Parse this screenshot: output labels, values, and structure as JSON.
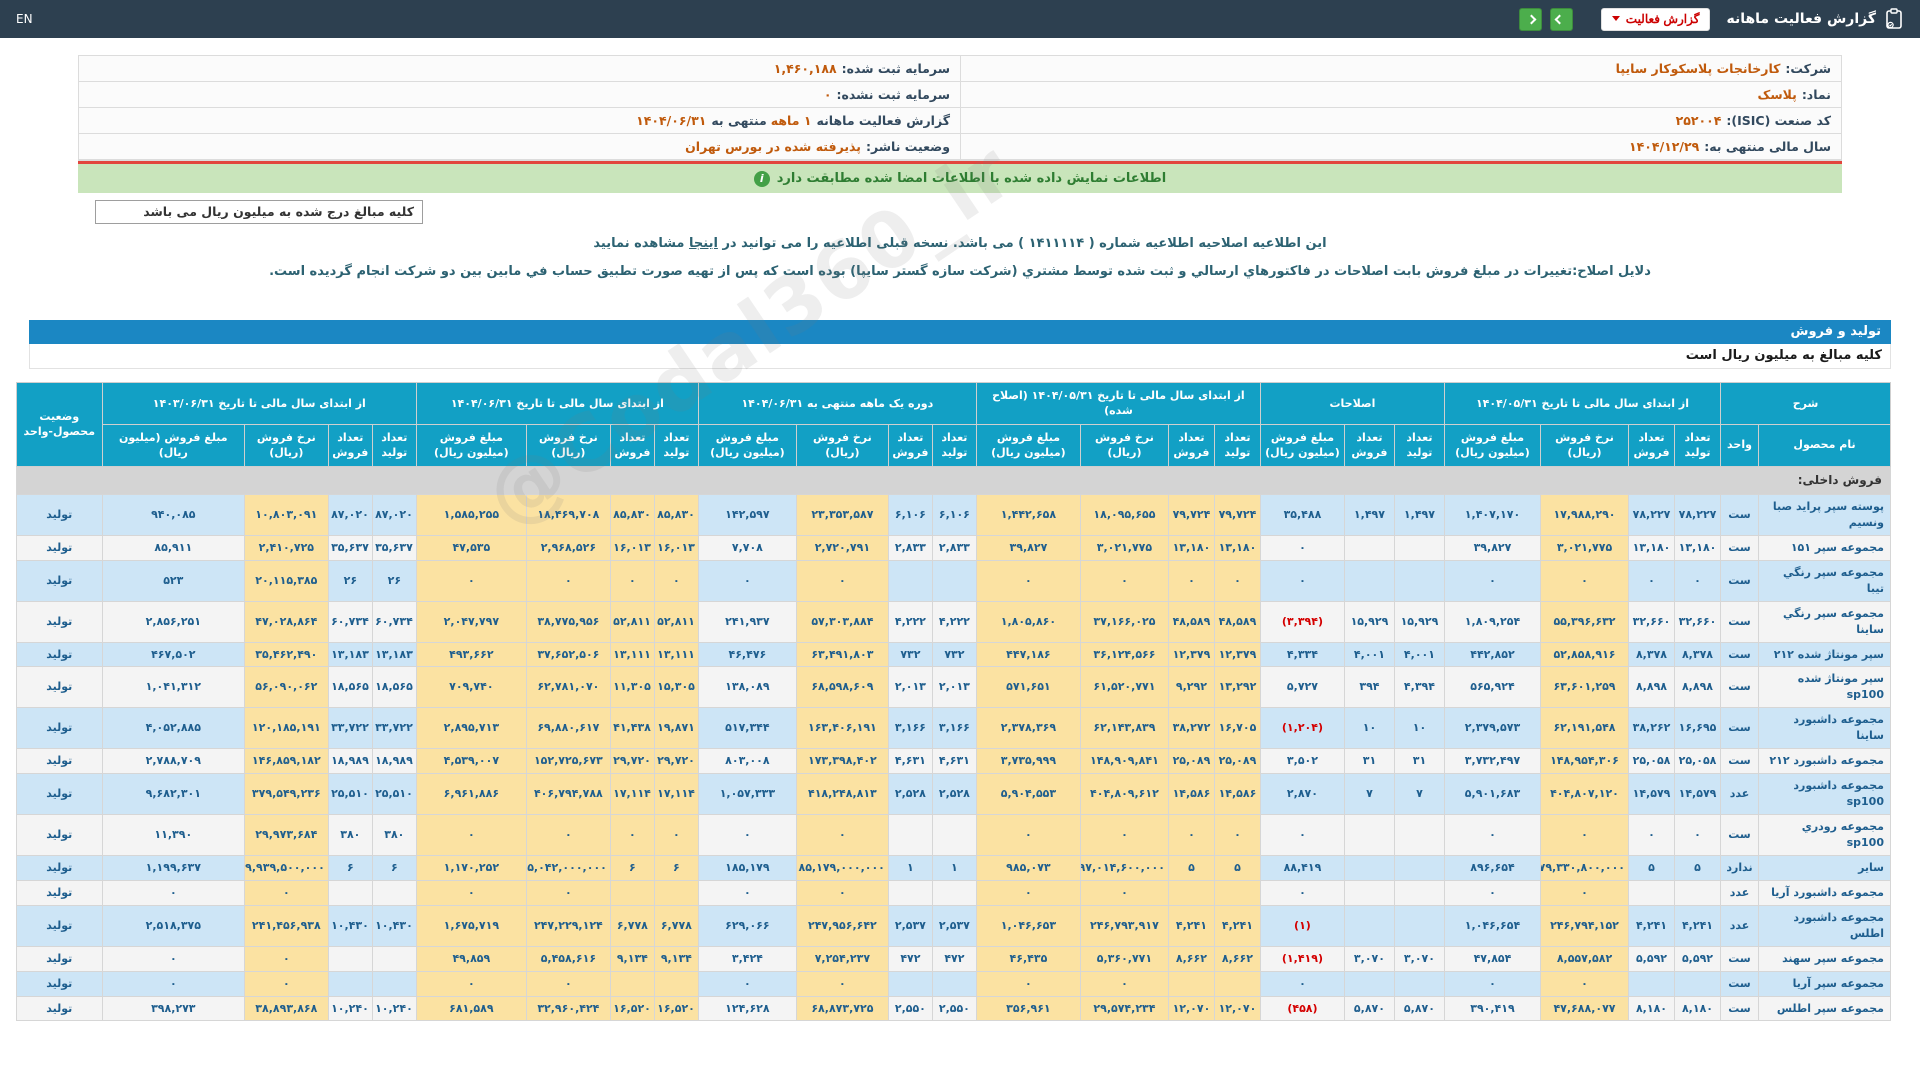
{
  "topbar": {
    "en": "EN",
    "title": "گزارش فعالیت ماهانه",
    "dropdown_label": "گزارش فعالیت",
    "accent_green": "#4cae4c",
    "accent_red": "#cc0000"
  },
  "info": {
    "right": [
      {
        "label": "شرکت:",
        "value": "کارخانجات پلاسکوکار سایپا"
      },
      {
        "label": "نماد:",
        "value": "پلاسک"
      },
      {
        "label": "کد صنعت (ISIC):",
        "value": "۲۵۲۰۰۴"
      },
      {
        "label": "سال مالی منتهی به:",
        "value": "۱۴۰۴/۱۲/۲۹"
      }
    ],
    "left": [
      {
        "label": "سرمایه ثبت شده:",
        "value": "۱,۴۶۰,۱۸۸",
        "label2": "",
        "value2": ""
      },
      {
        "label": "سرمایه ثبت نشده:",
        "value": "۰",
        "label2": "",
        "value2": ""
      },
      {
        "label": "گزارش فعالیت ماهانه",
        "value": "۱ ماهه",
        "label2": "منتهی به",
        "value2": "۱۴۰۴/۰۶/۳۱"
      },
      {
        "label": "وضعیت ناشر:",
        "value": "پذیرفته شده در بورس تهران",
        "label2": "",
        "value2": ""
      }
    ]
  },
  "banner": {
    "text": "اطلاعات نمایش داده شده با اطلاعات امضا شده مطابقت دارد",
    "icon": "info-icon",
    "color": "#2e7d32"
  },
  "million_note": "کلیه مبالغ درج شده به میلیون ریال می باشد",
  "notice": {
    "pre": "این اطلاعیه اصلاحیه اطلاعیه شماره ( ۱۴۱۱۱۱۴ ) می باشد. نسخه قبلی اطلاعیه را می توانید در",
    "link": "اینجا",
    "post": "مشاهده نمایید"
  },
  "reason": "دلایل اصلاح:تغییرات در مبلغ فروش بابت اصلاحات در فاکتورهاي ارسالي و ثبت شده توسط مشتري (شرکت سازه گستر سایپا) بوده است که پس از تهیه صورت تطبیق حساب في مابین بین دو شرکت انجام گردیده است.",
  "section_bar": "تولید و فروش",
  "units_row": "کلیه مبالغ به میلیون ریال است",
  "watermark": "@Codal360_ir",
  "table": {
    "desc": {
      "label": "شرح",
      "cols": [
        "نام محصول",
        "واحد"
      ]
    },
    "status_col": "وضعیت محصول-واحد",
    "sub": {
      "prod": "تعداد تولید",
      "sold": "تعداد فروش",
      "rate": "نرخ فروش (ریال)",
      "amount": "مبلغ فروش (میلیون ریال)"
    },
    "groups": [
      {
        "label": "از ابتدای سال مالی تا تاریخ ۱۴۰۴/۰۵/۳۱",
        "cols": [
          "prod",
          "sold",
          "rate",
          "amount"
        ]
      },
      {
        "label": "اصلاحات",
        "cols": [
          "prod",
          "sold",
          "amount"
        ]
      },
      {
        "label": "از ابتدای سال مالی تا تاریخ ۱۴۰۴/۰۵/۳۱ (اصلاح شده)",
        "cols": [
          "prod",
          "sold",
          "rate",
          "amount"
        ]
      },
      {
        "label": "دوره یک ماهه منتهی به ۱۴۰۴/۰۶/۳۱",
        "cols": [
          "prod",
          "sold",
          "rate",
          "amount"
        ]
      },
      {
        "label": "از ابتدای سال مالی تا تاریخ ۱۴۰۴/۰۶/۳۱",
        "cols": [
          "prod",
          "sold",
          "rate",
          "amount"
        ]
      },
      {
        "label": "از ابتدای سال مالی تا تاریخ ۱۴۰۳/۰۶/۳۱",
        "cols": [
          "prod",
          "sold",
          "rate",
          "amount"
        ]
      }
    ],
    "yellow_cells": [
      2,
      7,
      8,
      9,
      10,
      13,
      15,
      16,
      17,
      18,
      21
    ],
    "section": "فروش داخلی:",
    "colors": {
      "row_blue": "#cde5f6",
      "row_white": "#f4f4f4",
      "cell_yellow": "#fbe2a2",
      "header_cyan": "#12a0c5",
      "negative_red": "#d40000"
    },
    "rows": [
      {
        "name": "پوسته سپر پراید صبا ونسیم",
        "unit": "ست",
        "status": "تولید",
        "cells": [
          "۷۸,۲۲۷",
          "۷۸,۲۲۷",
          "۱۷,۹۸۸,۲۹۰",
          "۱,۴۰۷,۱۷۰",
          "۱,۴۹۷",
          "۱,۴۹۷",
          "۳۵,۴۸۸",
          "۷۹,۷۲۴",
          "۷۹,۷۲۴",
          "۱۸,۰۹۵,۶۵۵",
          "۱,۴۴۲,۶۵۸",
          "۶,۱۰۶",
          "۶,۱۰۶",
          "۲۳,۳۵۳,۵۸۷",
          "۱۴۲,۵۹۷",
          "۸۵,۸۳۰",
          "۸۵,۸۳۰",
          "۱۸,۴۶۹,۷۰۸",
          "۱,۵۸۵,۲۵۵",
          "۸۷,۰۲۰",
          "۸۷,۰۲۰",
          "۱۰,۸۰۳,۰۹۱",
          "۹۴۰,۰۸۵"
        ]
      },
      {
        "name": "مجموعه سپر ۱۵۱",
        "unit": "ست",
        "status": "تولید",
        "cells": [
          "۱۳,۱۸۰",
          "۱۳,۱۸۰",
          "۳,۰۲۱,۷۷۵",
          "۳۹,۸۲۷",
          "",
          "",
          "۰",
          "۱۳,۱۸۰",
          "۱۳,۱۸۰",
          "۳,۰۲۱,۷۷۵",
          "۳۹,۸۲۷",
          "۲,۸۳۳",
          "۲,۸۳۳",
          "۲,۷۲۰,۷۹۱",
          "۷,۷۰۸",
          "۱۶,۰۱۳",
          "۱۶,۰۱۳",
          "۲,۹۶۸,۵۲۶",
          "۴۷,۵۳۵",
          "۳۵,۶۳۷",
          "۳۵,۶۳۷",
          "۲,۴۱۰,۷۲۵",
          "۸۵,۹۱۱"
        ]
      },
      {
        "name": "مجموعه سپر رنگي تیبا",
        "unit": "ست",
        "status": "تولید",
        "cells": [
          "۰",
          "۰",
          "۰",
          "۰",
          "",
          "",
          "۰",
          "۰",
          "۰",
          "۰",
          "۰",
          "",
          "",
          "۰",
          "۰",
          "۰",
          "۰",
          "۰",
          "۰",
          "۲۶",
          "۲۶",
          "۲۰,۱۱۵,۳۸۵",
          "۵۲۳"
        ]
      },
      {
        "name": "مجموعه سپر رنگي ساینا",
        "unit": "ست",
        "status": "تولید",
        "cells": [
          "۳۲,۶۶۰",
          "۳۲,۶۶۰",
          "۵۵,۳۹۶,۶۳۲",
          "۱,۸۰۹,۲۵۴",
          "۱۵,۹۲۹",
          "۱۵,۹۲۹",
          "(۳,۳۹۴)",
          "۴۸,۵۸۹",
          "۴۸,۵۸۹",
          "۳۷,۱۶۶,۰۲۵",
          "۱,۸۰۵,۸۶۰",
          "۴,۲۲۲",
          "۴,۲۲۲",
          "۵۷,۳۰۳,۸۸۴",
          "۲۴۱,۹۳۷",
          "۵۲,۸۱۱",
          "۵۲,۸۱۱",
          "۳۸,۷۷۵,۹۵۶",
          "۲,۰۴۷,۷۹۷",
          "۶۰,۷۳۴",
          "۶۰,۷۳۴",
          "۴۷,۰۲۸,۸۶۴",
          "۲,۸۵۶,۲۵۱"
        ]
      },
      {
        "name": "سپر مونتاژ شده ۲۱۲",
        "unit": "ست",
        "status": "تولید",
        "cells": [
          "۸,۳۷۸",
          "۸,۳۷۸",
          "۵۲,۸۵۸,۹۱۶",
          "۴۴۲,۸۵۲",
          "۴,۰۰۱",
          "۴,۰۰۱",
          "۴,۳۳۴",
          "۱۲,۳۷۹",
          "۱۲,۳۷۹",
          "۳۶,۱۲۴,۵۶۶",
          "۴۴۷,۱۸۶",
          "۷۳۲",
          "۷۳۲",
          "۶۳,۴۹۱,۸۰۳",
          "۴۶,۴۷۶",
          "۱۳,۱۱۱",
          "۱۳,۱۱۱",
          "۳۷,۶۵۲,۵۰۶",
          "۴۹۳,۶۶۲",
          "۱۳,۱۸۳",
          "۱۳,۱۸۳",
          "۳۵,۴۶۲,۴۹۰",
          "۴۶۷,۵۰۲"
        ]
      },
      {
        "name": "سپر مونتاژ شده sp100",
        "unit": "ست",
        "status": "تولید",
        "cells": [
          "۸,۸۹۸",
          "۸,۸۹۸",
          "۶۳,۶۰۱,۲۵۹",
          "۵۶۵,۹۲۴",
          "۴,۳۹۴",
          "۳۹۴",
          "۵,۷۲۷",
          "۱۳,۲۹۲",
          "۹,۲۹۲",
          "۶۱,۵۲۰,۷۷۱",
          "۵۷۱,۶۵۱",
          "۲,۰۱۳",
          "۲,۰۱۳",
          "۶۸,۵۹۸,۶۰۹",
          "۱۳۸,۰۸۹",
          "۱۵,۳۰۵",
          "۱۱,۳۰۵",
          "۶۲,۷۸۱,۰۷۰",
          "۷۰۹,۷۴۰",
          "۱۸,۵۶۵",
          "۱۸,۵۶۵",
          "۵۶,۰۹۰,۰۶۲",
          "۱,۰۴۱,۳۱۲"
        ]
      },
      {
        "name": "مجموعه داشبورد ساینا",
        "unit": "ست",
        "status": "تولید",
        "cells": [
          "۱۶,۶۹۵",
          "۳۸,۲۶۲",
          "۶۲,۱۹۱,۵۴۸",
          "۲,۳۷۹,۵۷۳",
          "۱۰",
          "۱۰",
          "(۱,۲۰۴)",
          "۱۶,۷۰۵",
          "۳۸,۲۷۲",
          "۶۲,۱۴۳,۸۳۹",
          "۲,۳۷۸,۳۶۹",
          "۳,۱۶۶",
          "۳,۱۶۶",
          "۱۶۳,۴۰۶,۱۹۱",
          "۵۱۷,۳۴۴",
          "۱۹,۸۷۱",
          "۴۱,۴۳۸",
          "۶۹,۸۸۰,۶۱۷",
          "۲,۸۹۵,۷۱۳",
          "۳۳,۷۲۲",
          "۳۳,۷۲۲",
          "۱۲۰,۱۸۵,۱۹۱",
          "۴,۰۵۲,۸۸۵"
        ]
      },
      {
        "name": "مجموعه داشبورد ۲۱۲",
        "unit": "ست",
        "status": "تولید",
        "cells": [
          "۲۵,۰۵۸",
          "۲۵,۰۵۸",
          "۱۴۸,۹۵۴,۳۰۶",
          "۳,۷۳۲,۴۹۷",
          "۳۱",
          "۳۱",
          "۳,۵۰۲",
          "۲۵,۰۸۹",
          "۲۵,۰۸۹",
          "۱۴۸,۹۰۹,۸۴۱",
          "۳,۷۳۵,۹۹۹",
          "۴,۶۳۱",
          "۴,۶۳۱",
          "۱۷۳,۳۹۸,۴۰۲",
          "۸۰۳,۰۰۸",
          "۲۹,۷۲۰",
          "۲۹,۷۲۰",
          "۱۵۲,۷۲۵,۶۷۳",
          "۴,۵۳۹,۰۰۷",
          "۱۸,۹۸۹",
          "۱۸,۹۸۹",
          "۱۴۶,۸۵۹,۱۸۲",
          "۲,۷۸۸,۷۰۹"
        ]
      },
      {
        "name": "مجموعه داشبورد sp100",
        "unit": "عدد",
        "status": "تولید",
        "cells": [
          "۱۴,۵۷۹",
          "۱۴,۵۷۹",
          "۴۰۴,۸۰۷,۱۲۰",
          "۵,۹۰۱,۶۸۳",
          "۷",
          "۷",
          "۲,۸۷۰",
          "۱۴,۵۸۶",
          "۱۴,۵۸۶",
          "۴۰۴,۸۰۹,۶۱۲",
          "۵,۹۰۴,۵۵۳",
          "۲,۵۲۸",
          "۲,۵۲۸",
          "۴۱۸,۲۴۸,۸۱۳",
          "۱,۰۵۷,۳۳۳",
          "۱۷,۱۱۴",
          "۱۷,۱۱۴",
          "۴۰۶,۷۹۴,۷۸۸",
          "۶,۹۶۱,۸۸۶",
          "۲۵,۵۱۰",
          "۲۵,۵۱۰",
          "۳۷۹,۵۴۹,۲۳۶",
          "۹,۶۸۲,۳۰۱"
        ]
      },
      {
        "name": "مجموعه رودري sp100",
        "unit": "ست",
        "status": "تولید",
        "cells": [
          "۰",
          "۰",
          "۰",
          "۰",
          "",
          "",
          "۰",
          "۰",
          "۰",
          "۰",
          "۰",
          "",
          "",
          "۰",
          "۰",
          "۰",
          "۰",
          "۰",
          "۰",
          "۳۸۰",
          "۳۸۰",
          "۲۹,۹۷۳,۶۸۴",
          "۱۱,۳۹۰"
        ]
      },
      {
        "name": "سایر",
        "unit": "ندارد",
        "status": "تولید",
        "cells": [
          "۵",
          "۵",
          "۱۷۹,۳۳۰,۸۰۰,۰۰۰",
          "۸۹۶,۶۵۴",
          "",
          "",
          "۸۸,۴۱۹",
          "۵",
          "۵",
          "۱۹۷,۰۱۴,۶۰۰,۰۰۰",
          "۹۸۵,۰۷۳",
          "۱",
          "۱",
          "۱۸۵,۱۷۹,۰۰۰,۰۰۰",
          "۱۸۵,۱۷۹",
          "۶",
          "۶",
          "۱۹۵,۰۴۲,۰۰۰,۰۰۰",
          "۱,۱۷۰,۲۵۲",
          "۶",
          "۶",
          "۱۹۹,۹۳۹,۵۰۰,۰۰۰",
          "۱,۱۹۹,۶۳۷"
        ]
      },
      {
        "name": "مجموعه داشبورد آریا",
        "unit": "عدد",
        "status": "تولید",
        "cells": [
          "",
          "",
          "۰",
          "۰",
          "",
          "",
          "۰",
          "",
          "",
          "۰",
          "۰",
          "",
          "",
          "۰",
          "۰",
          "",
          "",
          "۰",
          "۰",
          "",
          "",
          "۰",
          "۰"
        ]
      },
      {
        "name": "مجموعه داشبورد اطلس",
        "unit": "عدد",
        "status": "تولید",
        "cells": [
          "۴,۲۴۱",
          "۴,۲۴۱",
          "۲۴۶,۷۹۴,۱۵۲",
          "۱,۰۴۶,۶۵۴",
          "",
          "",
          "(۱)",
          "۴,۲۴۱",
          "۴,۲۴۱",
          "۲۴۶,۷۹۳,۹۱۷",
          "۱,۰۴۶,۶۵۳",
          "۲,۵۳۷",
          "۲,۵۳۷",
          "۲۴۷,۹۵۶,۶۴۲",
          "۶۲۹,۰۶۶",
          "۶,۷۷۸",
          "۶,۷۷۸",
          "۲۴۷,۲۲۹,۱۲۴",
          "۱,۶۷۵,۷۱۹",
          "۱۰,۴۳۰",
          "۱۰,۴۳۰",
          "۲۴۱,۴۵۶,۹۳۸",
          "۲,۵۱۸,۳۷۵"
        ]
      },
      {
        "name": "مجموعه سپر سهند",
        "unit": "ست",
        "status": "تولید",
        "cells": [
          "۵,۵۹۲",
          "۵,۵۹۲",
          "۸,۵۵۷,۵۸۲",
          "۴۷,۸۵۴",
          "۳,۰۷۰",
          "۳,۰۷۰",
          "(۱,۴۱۹)",
          "۸,۶۶۲",
          "۸,۶۶۲",
          "۵,۳۶۰,۷۷۱",
          "۴۶,۴۳۵",
          "۴۷۲",
          "۴۷۲",
          "۷,۲۵۴,۲۳۷",
          "۳,۴۲۴",
          "۹,۱۳۴",
          "۹,۱۳۴",
          "۵,۴۵۸,۶۱۶",
          "۴۹,۸۵۹",
          "",
          "",
          "۰",
          "۰"
        ]
      },
      {
        "name": "مجموعه سپر آریا",
        "unit": "ست",
        "status": "تولید",
        "cells": [
          "",
          "",
          "۰",
          "۰",
          "",
          "",
          "۰",
          "",
          "",
          "۰",
          "۰",
          "",
          "",
          "۰",
          "۰",
          "",
          "",
          "۰",
          "۰",
          "",
          "",
          "۰",
          "۰"
        ]
      },
      {
        "name": "مجموعه سپر اطلس",
        "unit": "ست",
        "status": "تولید",
        "cells": [
          "۸,۱۸۰",
          "۸,۱۸۰",
          "۴۷,۶۸۸,۰۷۷",
          "۳۹۰,۴۱۹",
          "۵,۸۷۰",
          "۵,۸۷۰",
          "(۴۵۸)",
          "۱۲,۰۷۰",
          "۱۲,۰۷۰",
          "۲۹,۵۷۴,۲۳۴",
          "۳۵۶,۹۶۱",
          "۲,۵۵۰",
          "۲,۵۵۰",
          "۶۸,۸۷۳,۷۲۵",
          "۱۲۴,۶۲۸",
          "۱۶,۵۲۰",
          "۱۶,۵۲۰",
          "۳۲,۹۶۰,۴۲۴",
          "۶۸۱,۵۸۹",
          "۱۰,۲۴۰",
          "۱۰,۲۴۰",
          "۳۸,۸۹۳,۸۶۸",
          "۳۹۸,۲۷۳"
        ]
      }
    ]
  }
}
